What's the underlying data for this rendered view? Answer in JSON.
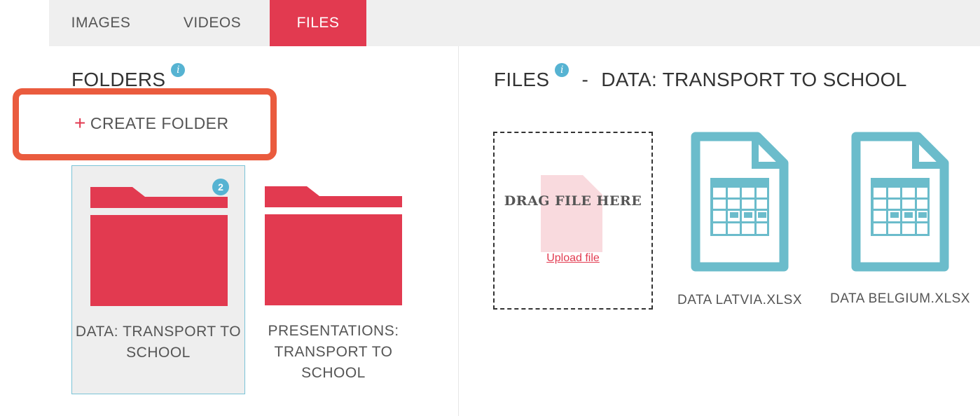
{
  "tabs": [
    {
      "label": "IMAGES",
      "active": false
    },
    {
      "label": "VIDEOS",
      "active": false
    },
    {
      "label": "FILES",
      "active": true
    }
  ],
  "folders_panel": {
    "title": "FOLDERS",
    "info_glyph": "i",
    "create_label": "CREATE FOLDER",
    "create_glyph": "+",
    "items": [
      {
        "label": "DATA: TRANSPORT TO SCHOOL",
        "badge": "2",
        "selected": true
      },
      {
        "label": "PRESENTATIONS: TRANSPORT TO SCHOOL",
        "badge": "",
        "selected": false
      }
    ]
  },
  "files_panel": {
    "title": "FILES",
    "info_glyph": "i",
    "separator": "-",
    "folder_name": "DATA: TRANSPORT TO SCHOOL",
    "dropzone": {
      "title": "DRAG FILE HERE",
      "upload_link": "Upload file"
    },
    "files": [
      {
        "name": "DATA LATVIA.XLSX",
        "icon": "spreadsheet-icon"
      },
      {
        "name": "DATA BELGIUM.XLSX",
        "icon": "spreadsheet-icon"
      }
    ]
  },
  "colors": {
    "accent": "#e23a50",
    "info": "#56b3d2",
    "file_icon": "#6bbccb",
    "highlight": "#ea5b3e",
    "tabbar": "#efefef"
  }
}
